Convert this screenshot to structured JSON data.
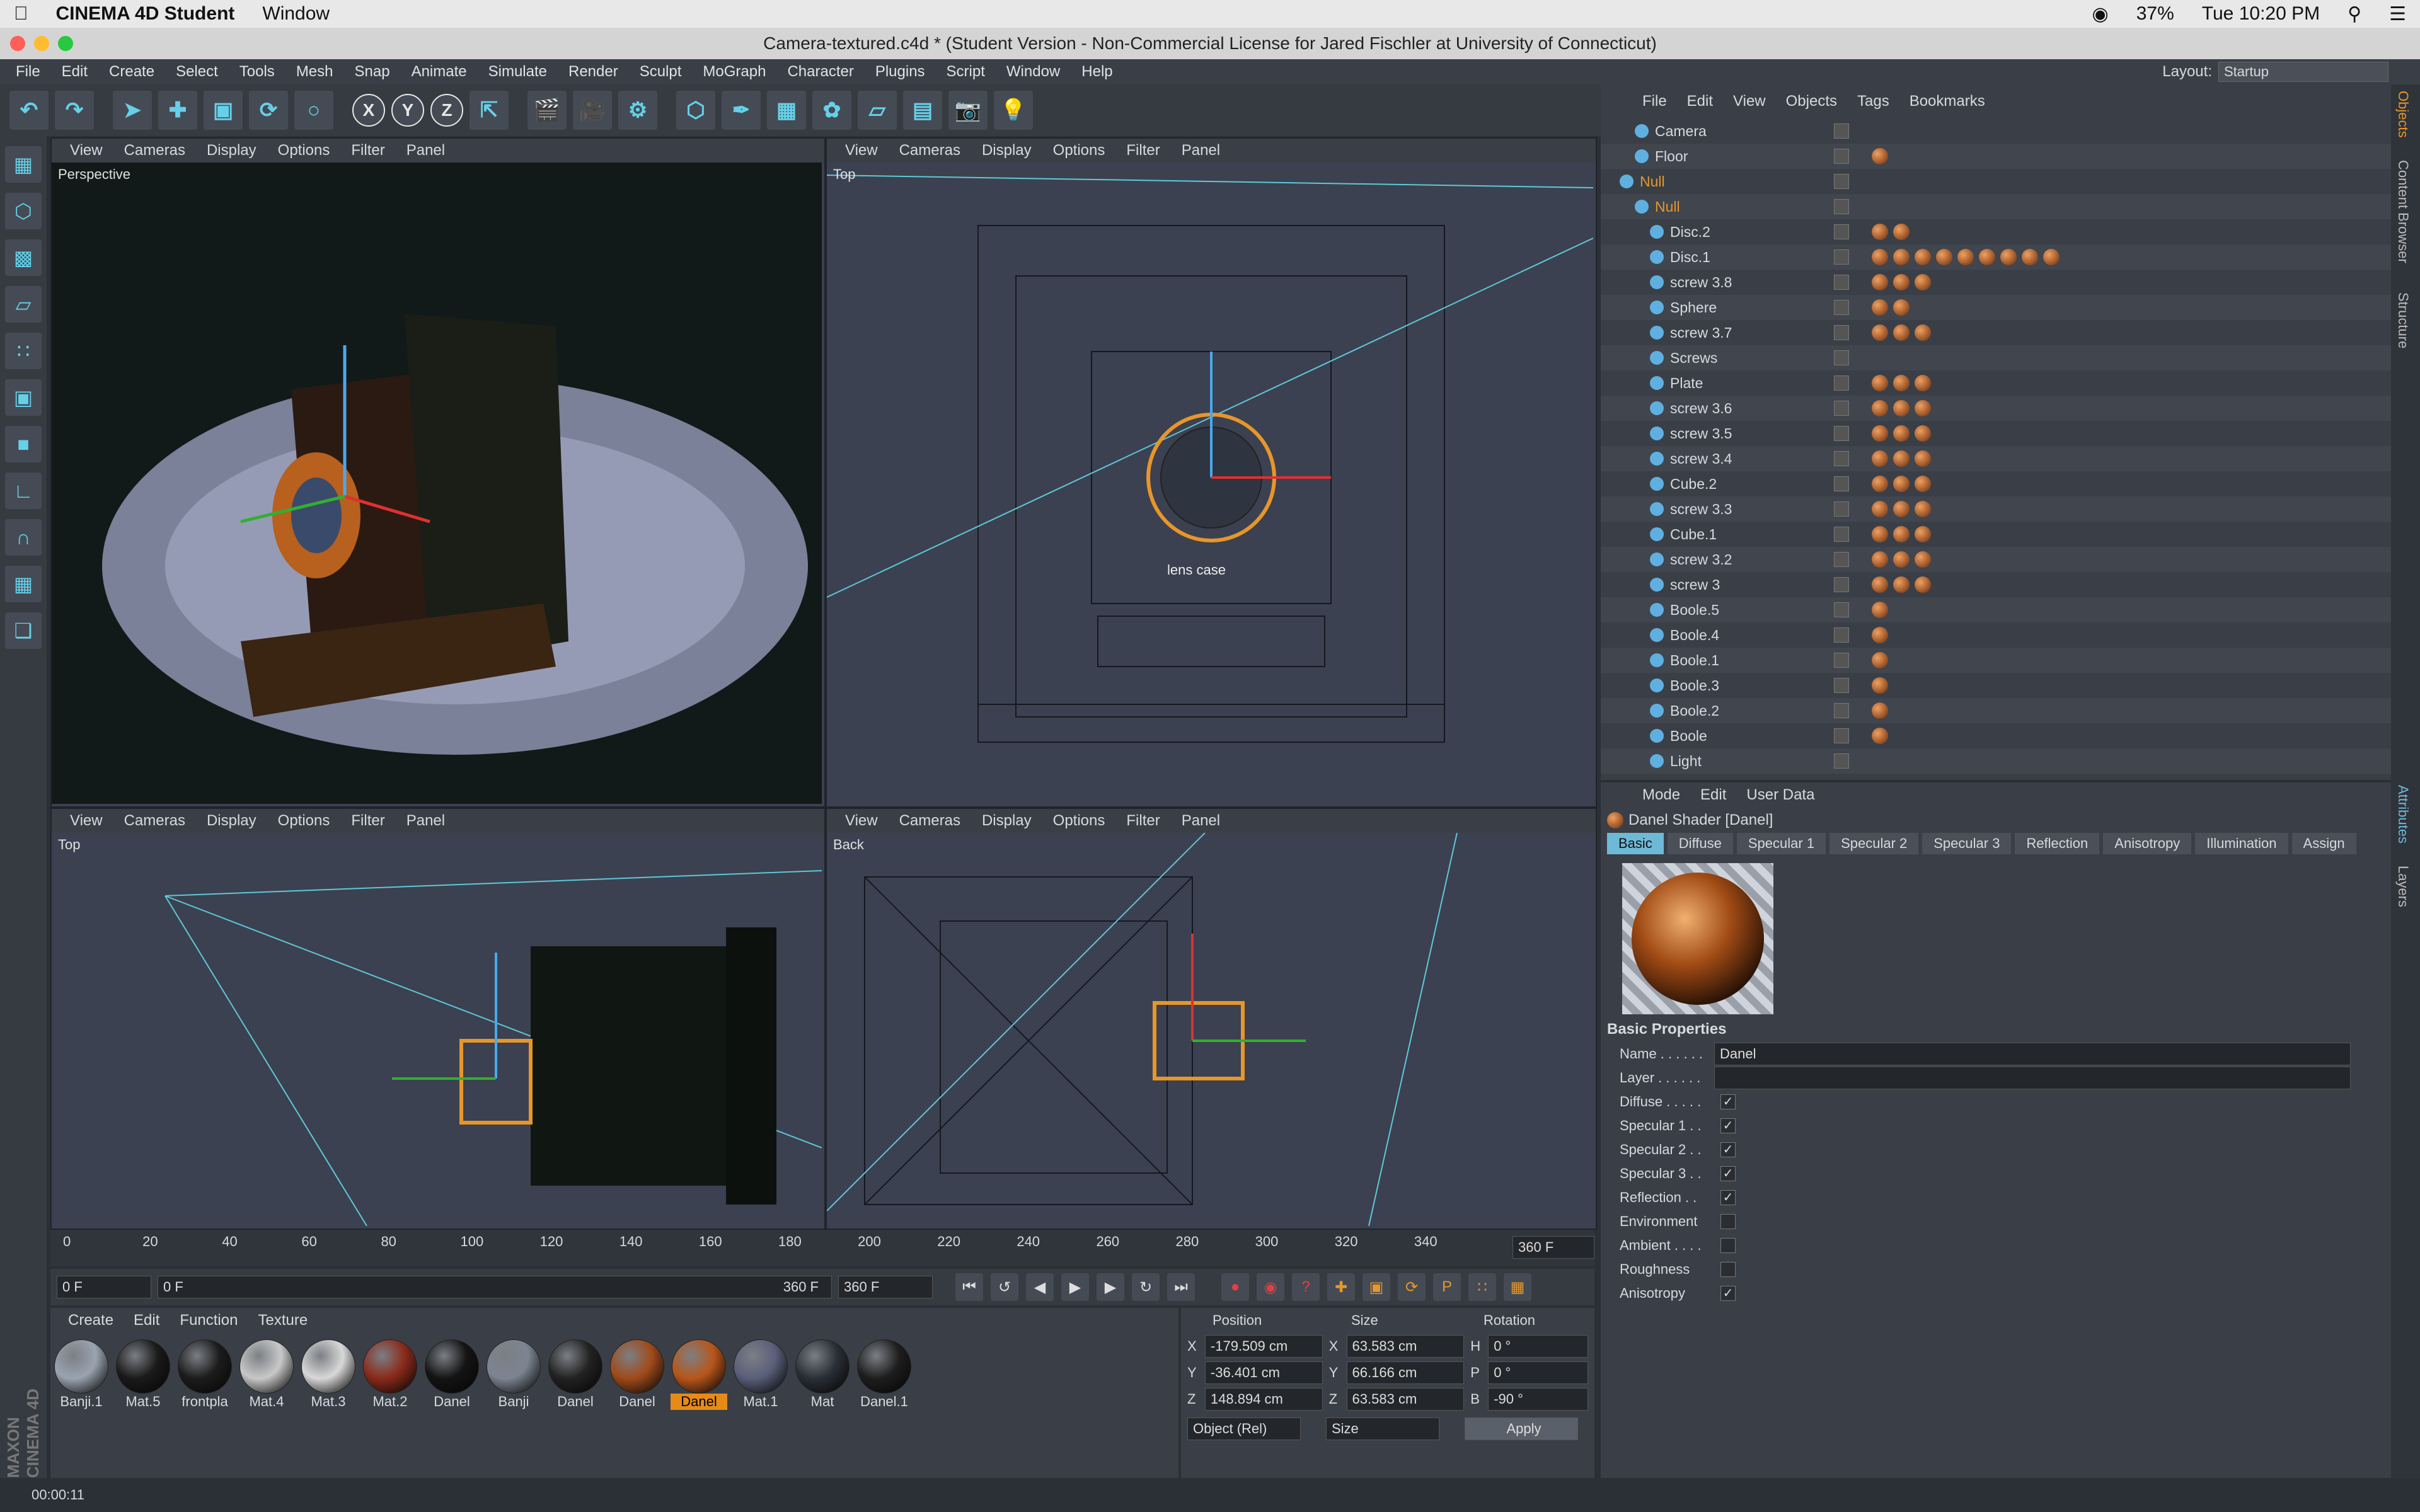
{
  "mac_menu": {
    "app": "CINEMA 4D Student",
    "window": "Window",
    "battery": "37%",
    "clock": "Tue 10:20 PM"
  },
  "window_title": "Camera-textured.c4d * (Student Version - Non-Commercial License for Jared Fischler at University of Connecticut)",
  "app_menu": [
    "File",
    "Edit",
    "Create",
    "Select",
    "Tools",
    "Mesh",
    "Snap",
    "Animate",
    "Simulate",
    "Render",
    "Sculpt",
    "MoGraph",
    "Character",
    "Plugins",
    "Script",
    "Window",
    "Help"
  ],
  "layout": {
    "label": "Layout:",
    "value": "Startup"
  },
  "axis_buttons": [
    "X",
    "Y",
    "Z"
  ],
  "viewport_menu": [
    "View",
    "Cameras",
    "Display",
    "Options",
    "Filter",
    "Panel"
  ],
  "viewports": {
    "tl": "Perspective",
    "tr": "Top",
    "bl": "Top",
    "br": "Back"
  },
  "viewport_labels": {
    "lens_case": "lens case"
  },
  "timeline": {
    "ticks": [
      "0",
      "20",
      "40",
      "60",
      "80",
      "100",
      "120",
      "140",
      "160",
      "180",
      "200",
      "220",
      "240",
      "260",
      "280",
      "300",
      "320",
      "340"
    ],
    "end_frame": "360 F"
  },
  "transport": {
    "start": "0 F",
    "current": "0 F",
    "range_end": "360 F",
    "max": "360 F"
  },
  "material_menu": [
    "Create",
    "Edit",
    "Function",
    "Texture"
  ],
  "materials": [
    {
      "name": "Banji.1",
      "color": "#9aa3b0"
    },
    {
      "name": "Mat.5",
      "color": "#1a1a1a"
    },
    {
      "name": "frontpla",
      "color": "#1c1c1c"
    },
    {
      "name": "Mat.4",
      "color": "#c8c8c8"
    },
    {
      "name": "Mat.3",
      "color": "#d8d8d8"
    },
    {
      "name": "Mat.2",
      "color": "#8a2a1a"
    },
    {
      "name": "Danel",
      "color": "#141414"
    },
    {
      "name": "Banji",
      "color": "#7d8592"
    },
    {
      "name": "Danel",
      "color": "#222222"
    },
    {
      "name": "Danel",
      "color": "#a04a1a"
    },
    {
      "name": "Danel",
      "color": "#b8561a",
      "selected": true
    },
    {
      "name": "Mat.1",
      "color": "#5a5f7a"
    },
    {
      "name": "Mat",
      "color": "#2a2e36"
    },
    {
      "name": "Danel.1",
      "color": "#1e1e1e"
    }
  ],
  "coords": {
    "headers": [
      "Position",
      "Size",
      "Rotation"
    ],
    "rows": [
      {
        "axis": "X",
        "pos": "-179.509 cm",
        "saxis": "X",
        "size": "63.583 cm",
        "raxis": "H",
        "rot": "0 °"
      },
      {
        "axis": "Y",
        "pos": "-36.401 cm",
        "saxis": "Y",
        "size": "66.166 cm",
        "raxis": "P",
        "rot": "0 °"
      },
      {
        "axis": "Z",
        "pos": "148.894 cm",
        "saxis": "Z",
        "size": "63.583 cm",
        "raxis": "B",
        "rot": "-90 °"
      }
    ],
    "mode": "Object (Rel)",
    "size_mode": "Size",
    "apply": "Apply"
  },
  "object_menu": [
    "File",
    "Edit",
    "View",
    "Objects",
    "Tags",
    "Bookmarks"
  ],
  "objects": [
    {
      "name": "Camera",
      "indent": 1,
      "tags": 0
    },
    {
      "name": "Floor",
      "indent": 1,
      "tags": 1
    },
    {
      "name": "Null",
      "indent": 0,
      "tags": 0,
      "orange": true
    },
    {
      "name": "Null",
      "indent": 1,
      "tags": 0,
      "orange": true
    },
    {
      "name": "Disc.2",
      "indent": 2,
      "tags": 2
    },
    {
      "name": "Disc.1",
      "indent": 2,
      "tags": 9
    },
    {
      "name": "screw 3.8",
      "indent": 2,
      "tags": 3
    },
    {
      "name": "Sphere",
      "indent": 2,
      "tags": 2
    },
    {
      "name": "screw 3.7",
      "indent": 2,
      "tags": 3
    },
    {
      "name": "Screws",
      "indent": 2,
      "tags": 0
    },
    {
      "name": "Plate",
      "indent": 2,
      "tags": 3
    },
    {
      "name": "screw 3.6",
      "indent": 2,
      "tags": 3
    },
    {
      "name": "screw 3.5",
      "indent": 2,
      "tags": 3
    },
    {
      "name": "screw 3.4",
      "indent": 2,
      "tags": 3
    },
    {
      "name": "Cube.2",
      "indent": 2,
      "tags": 3
    },
    {
      "name": "screw 3.3",
      "indent": 2,
      "tags": 3
    },
    {
      "name": "Cube.1",
      "indent": 2,
      "tags": 3
    },
    {
      "name": "screw 3.2",
      "indent": 2,
      "tags": 3
    },
    {
      "name": "screw 3",
      "indent": 2,
      "tags": 3
    },
    {
      "name": "Boole.5",
      "indent": 2,
      "tags": 1
    },
    {
      "name": "Boole.4",
      "indent": 2,
      "tags": 1
    },
    {
      "name": "Boole.1",
      "indent": 2,
      "tags": 1
    },
    {
      "name": "Boole.3",
      "indent": 2,
      "tags": 1
    },
    {
      "name": "Boole.2",
      "indent": 2,
      "tags": 1
    },
    {
      "name": "Boole",
      "indent": 2,
      "tags": 1
    },
    {
      "name": "Light",
      "indent": 2,
      "tags": 0
    }
  ],
  "attr": {
    "menu": [
      "Mode",
      "Edit",
      "User Data"
    ],
    "title": "Danel Shader [Danel]",
    "tabs": [
      "Basic",
      "Diffuse",
      "Specular 1",
      "Specular 2",
      "Specular 3",
      "Reflection",
      "Anisotropy",
      "Illumination",
      "Assign"
    ],
    "section": "Basic Properties",
    "name_label": "Name . . . . . .",
    "name_value": "Danel",
    "layer_label": "Layer . . . . . .",
    "channels": [
      {
        "label": "Diffuse . . . . .",
        "checked": true
      },
      {
        "label": "Specular 1 . .",
        "checked": true
      },
      {
        "label": "Specular 2 . .",
        "checked": true
      },
      {
        "label": "Specular 3 . .",
        "checked": true
      },
      {
        "label": "Reflection . .",
        "checked": true
      },
      {
        "label": "Environment",
        "checked": false
      },
      {
        "label": "Ambient . . . .",
        "checked": false
      },
      {
        "label": "Roughness",
        "checked": false
      },
      {
        "label": "Anisotropy",
        "checked": true
      }
    ]
  },
  "side_tabs": [
    "Objects",
    "Content Browser",
    "Structure",
    "Attributes",
    "Layers"
  ],
  "status_time": "00:00:11",
  "brand": "MAXON CINEMA 4D"
}
